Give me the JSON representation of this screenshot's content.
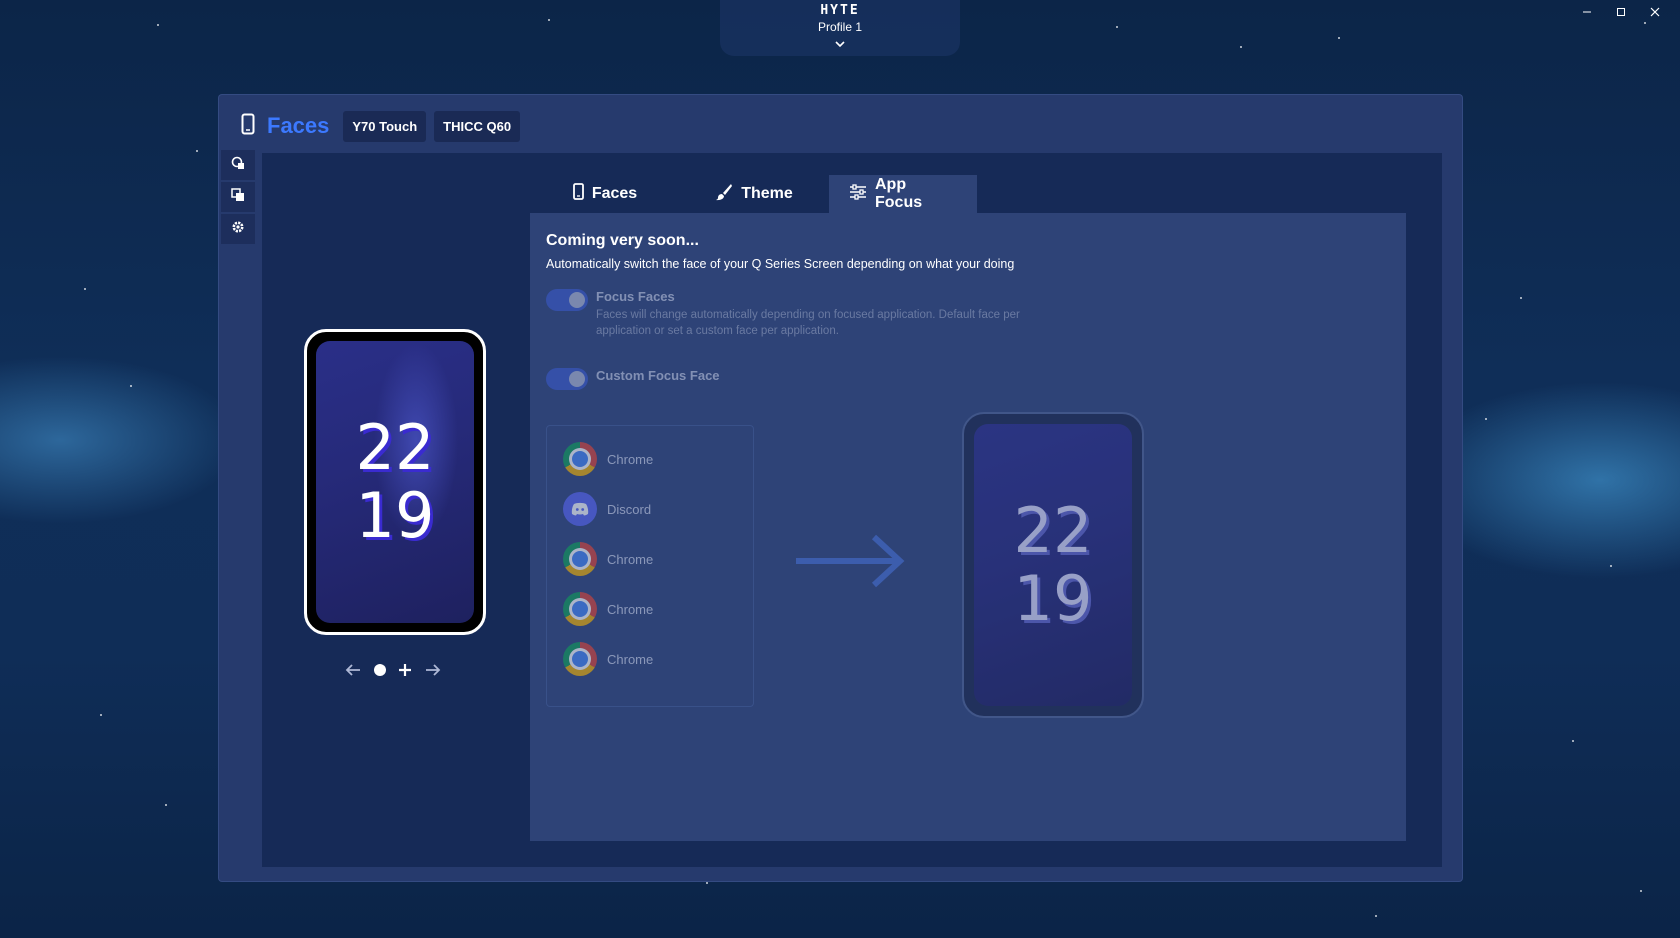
{
  "window": {
    "brand": "HYTE",
    "profile": "Profile 1"
  },
  "header": {
    "title": "Faces",
    "devices": [
      "Y70 Touch",
      "THICC Q60"
    ]
  },
  "preview": {
    "hour": "22",
    "minute": "19"
  },
  "tabs": [
    {
      "label": "Faces",
      "icon": "phone-icon",
      "active": false
    },
    {
      "label": "Theme",
      "icon": "brush-icon",
      "active": false
    },
    {
      "label": "App Focus",
      "icon": "sliders-icon",
      "active": true
    }
  ],
  "app_focus": {
    "title": "Coming very soon...",
    "subtitle": "Automatically switch the face of your Q Series Screen depending on what your doing",
    "focus_faces": {
      "label": "Focus Faces",
      "description": "Faces will change automatically depending on focused application. Default face per application or set a custom face per application.",
      "enabled": true
    },
    "custom_focus_face": {
      "label": "Custom Focus Face",
      "enabled": true
    },
    "apps": [
      {
        "name": "Chrome",
        "icon": "chrome-icon"
      },
      {
        "name": "Discord",
        "icon": "discord-icon"
      },
      {
        "name": "Chrome",
        "icon": "chrome-icon"
      },
      {
        "name": "Chrome",
        "icon": "chrome-icon"
      },
      {
        "name": "Chrome",
        "icon": "chrome-icon"
      }
    ],
    "target_face": {
      "hour": "22",
      "minute": "19"
    }
  },
  "colors": {
    "accent": "#3c79ff",
    "panel": "#2e4377",
    "background": "#0f2d57"
  }
}
